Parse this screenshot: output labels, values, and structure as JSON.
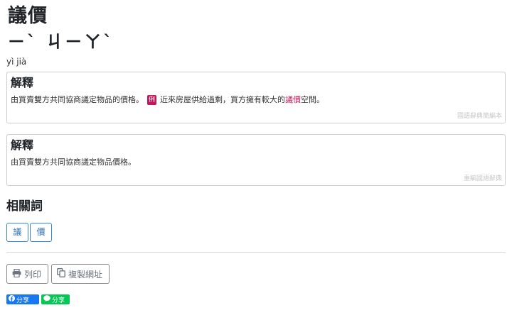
{
  "entry": {
    "word": "議價",
    "zhuyin": "ㄧˋ ㄐㄧㄚˋ",
    "pinyin": "yì jià"
  },
  "definitions": [
    {
      "heading": "解釋",
      "text_before": "由買賣雙方共同協商議定物品的價格。",
      "example_badge": "例",
      "example_before": "近來房屋供給過剩，買方擁有較大的",
      "example_highlight": "議價",
      "example_after": "空間。",
      "source": "國語辭典簡編本"
    },
    {
      "heading": "解釋",
      "text": "由買賣雙方共同協商議定物品價格。",
      "source": "重編國語辭典"
    }
  ],
  "related": {
    "heading": "相關詞",
    "chips": [
      "議",
      "價"
    ]
  },
  "actions": {
    "print_label": "列印",
    "copy_label": "複製網址"
  },
  "share": {
    "facebook_label": "分享",
    "line_label": "分享"
  },
  "colors": {
    "highlight": "#c2185b",
    "chip_border": "#3a86c8",
    "facebook": "#1877f2",
    "line": "#06c755"
  }
}
